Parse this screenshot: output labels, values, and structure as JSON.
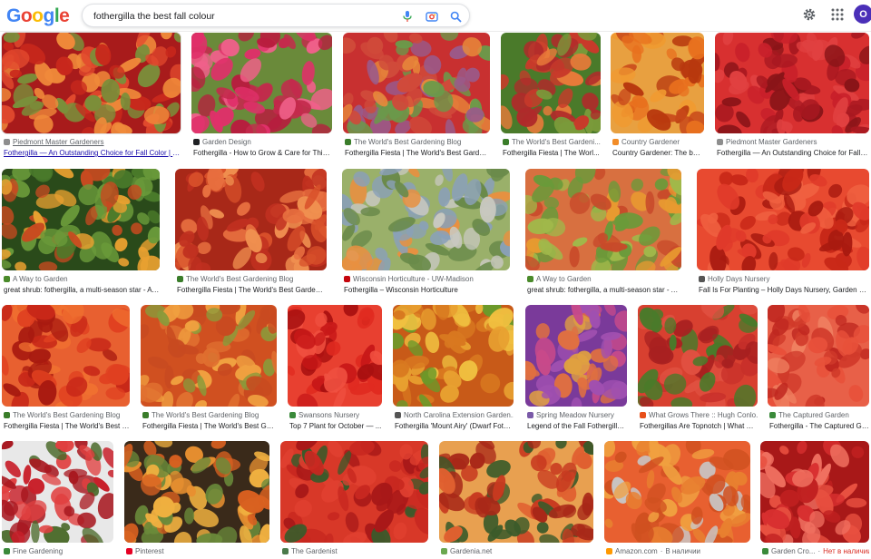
{
  "brand": {
    "logo_letters": [
      "G",
      "o",
      "o",
      "g",
      "l",
      "e"
    ],
    "logo_colors": [
      "#4285F4",
      "#EA4335",
      "#FBBC05",
      "#4285F4",
      "#34A853",
      "#EA4335"
    ]
  },
  "search": {
    "query": "fothergilla the best fall colour"
  },
  "icons": {
    "mic": "microphone-icon",
    "camera": "camera-lens-icon",
    "search": "search-icon",
    "settings": "gear-icon",
    "apps": "apps-grid-icon"
  },
  "account": {
    "initial": "O",
    "color": "#4a2fb8"
  },
  "results": [
    {
      "source": "Piedmont Master Gardeners",
      "title": "Fothergilla — An Outstanding Choice for Fall Color | Pi...",
      "fav": "#8e8e8e",
      "palette": [
        "#c8281c",
        "#e24a2e",
        "#f08a3a",
        "#7a8f3a",
        "#a81b1b"
      ]
    },
    {
      "source": "Garden Design",
      "title": "Fothergilla - How to Grow & Care for This ...",
      "fav": "#202124",
      "palette": [
        "#e0306a",
        "#c42a4c",
        "#f0608a",
        "#b81d3e",
        "#6a8a3a"
      ]
    },
    {
      "source": "The World's Best Gardening Blog",
      "title": "Fothergilla Fiesta | The World's Best Gardening ...",
      "fav": "#3a7d2a",
      "palette": [
        "#d04a3a",
        "#e88a3a",
        "#9a5a8a",
        "#6a9a4a",
        "#c83030"
      ]
    },
    {
      "source": "The World's Best Gardeni...",
      "title": "Fothergilla Fiesta | The Worl...",
      "fav": "#3a7d2a",
      "palette": [
        "#c83a2a",
        "#e87a3a",
        "#7a9a3a",
        "#b02a2a",
        "#4a7a2a"
      ]
    },
    {
      "source": "Country Gardener",
      "title": "Country Gardener: The bes...",
      "fav": "#f28c28",
      "palette": [
        "#e8701e",
        "#c8481a",
        "#f09a30",
        "#b8380e",
        "#e8a040"
      ]
    },
    {
      "source": "Piedmont Master Gardeners",
      "title": "Fothergilla — An Outstanding Choice for Fall C...",
      "fav": "#8e8e8e",
      "palette": [
        "#c8202a",
        "#a81820",
        "#e04040",
        "#8a1418",
        "#d83030"
      ]
    },
    {
      "source": "A Way to Garden",
      "title": "great shrub: fothergilla, a multi-season star - A ...",
      "fav": "#4a8a2a",
      "palette": [
        "#4a7a2a",
        "#e8a030",
        "#c84a20",
        "#6a9a3a",
        "#2a4a1a"
      ]
    },
    {
      "source": "The World's Best Gardening Blog",
      "title": "Fothergilla Fiesta | The World's Best Gardening ...",
      "fav": "#3a7d2a",
      "palette": [
        "#d8502a",
        "#e87040",
        "#c03020",
        "#f09050",
        "#a82818"
      ]
    },
    {
      "source": "Wisconsin Horticulture - UW-Madison",
      "title": "Fothergilla – Wisconsin Horticulture",
      "fav": "#c5050c",
      "palette": [
        "#6a8a4a",
        "#e89040",
        "#8aa0b8",
        "#c8c8c0",
        "#9ab06a"
      ]
    },
    {
      "source": "A Way to Garden",
      "title": "great shrub: fothergilla, a multi-season star - A W...",
      "fav": "#4a8a2a",
      "palette": [
        "#e89a30",
        "#c84a2a",
        "#6a9a3a",
        "#a0b84a",
        "#d87040"
      ]
    },
    {
      "source": "Holly Days Nursery",
      "title": "Fall Is For Planting – Holly Days Nursery, Garden Cen...",
      "fav": "#555555",
      "palette": [
        "#e03a2a",
        "#c82818",
        "#f06040",
        "#a81a10",
        "#e84a30"
      ]
    },
    {
      "source": "The World's Best Gardening Blog",
      "title": "Fothergilla Fiesta | The World's Best G...",
      "fav": "#3a7d2a",
      "palette": [
        "#e04020",
        "#c82818",
        "#f07030",
        "#a81a10",
        "#e86030"
      ]
    },
    {
      "source": "The World's Best Gardening Blog",
      "title": "Fothergilla Fiesta | The World's Best Gar...",
      "fav": "#3a7d2a",
      "palette": [
        "#e07030",
        "#c84a20",
        "#f0a040",
        "#8a9a3a",
        "#d05020"
      ]
    },
    {
      "source": "Swansons Nursery",
      "title": "Top 7 Plant for October — ...",
      "fav": "#3a8a3a",
      "palette": [
        "#e02a20",
        "#c81818",
        "#f05040",
        "#a81010",
        "#e84030"
      ]
    },
    {
      "source": "North Carolina Extension Garden...",
      "title": "Fothergilla 'Mount Airy' (Dwarf Foth...",
      "fav": "#555555",
      "palette": [
        "#e8a030",
        "#d87820",
        "#6a9a2a",
        "#f0c040",
        "#c85a18"
      ]
    },
    {
      "source": "Spring Meadow Nursery",
      "title": "Legend of the Fall Fothergilla ...",
      "fav": "#7a5aa8",
      "palette": [
        "#a050b0",
        "#e07040",
        "#c84a8a",
        "#e0a040",
        "#7a3a9a"
      ]
    },
    {
      "source": "What Grows There :: Hugh Conlo...",
      "title": "Fothergillas Are Topnotch | What G...",
      "fav": "#e8501a",
      "palette": [
        "#c8302a",
        "#e05040",
        "#4a7a2a",
        "#a82020",
        "#d84030"
      ]
    },
    {
      "source": "The Captured Garden",
      "title": "Fothergilla - The Captured Ga...",
      "fav": "#3a8a3a",
      "palette": [
        "#e8503a",
        "#d03a2a",
        "#f08060",
        "#c02820",
        "#e86048"
      ]
    },
    {
      "source": "Fine Gardening",
      "title": "",
      "fav": "#3a8a3a",
      "palette": [
        "#c8202a",
        "#e04040",
        "#4a6a2a",
        "#a81820",
        "#e8e8e8"
      ]
    },
    {
      "source": "Pinterest",
      "title": "",
      "fav": "#e60023",
      "palette": [
        "#e89030",
        "#d86020",
        "#6a8a3a",
        "#f0b040",
        "#3a2a1a"
      ]
    },
    {
      "source": "The Gardenist",
      "title": "",
      "fav": "#4a7a4a",
      "palette": [
        "#c82820",
        "#e04030",
        "#a81818",
        "#3a5a2a",
        "#d83828"
      ]
    },
    {
      "source": "Gardenia.net",
      "title": "",
      "fav": "#6aa84f",
      "palette": [
        "#c83a20",
        "#e06030",
        "#3a5a2a",
        "#a82818",
        "#e8a050"
      ]
    },
    {
      "source": "Amazon.com",
      "badge": "В наличии",
      "title": "",
      "fav": "#ff9900",
      "palette": [
        "#e88030",
        "#d05020",
        "#f0a040",
        "#c8c8c8",
        "#e86030"
      ]
    },
    {
      "source": "Garden Cro...",
      "badge": "Нет в наличии",
      "title": "",
      "fav": "#3a8a3a",
      "palette": [
        "#d83030",
        "#e85040",
        "#c02020",
        "#f07060",
        "#a81818"
      ]
    }
  ]
}
